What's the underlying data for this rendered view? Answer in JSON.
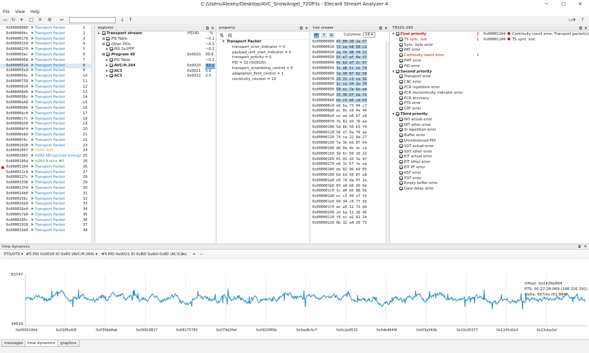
{
  "window": {
    "title": "C:/Users/Alexey/Desktop/AVC_SnowAngel_720P.ts - Elecard Stream Analyzer 4"
  },
  "menu": [
    "File",
    "View",
    "Help"
  ],
  "packets": [
    {
      "addr": "0x00000000",
      "label": "Transport Packet",
      "n": "1",
      "type": "pkt"
    },
    {
      "addr": "0x000000bc",
      "label": "Transport Packet",
      "n": "2",
      "type": "pkt"
    },
    {
      "addr": "0x00000178",
      "label": "Transport Packet",
      "n": "3",
      "type": "pkt"
    },
    {
      "addr": "0x00000234",
      "label": "Transport Packet",
      "n": "4",
      "type": "pkt"
    },
    {
      "addr": "0x000002f0",
      "label": "Transport Packet",
      "n": "5",
      "type": "pkt"
    },
    {
      "addr": "0x000003ac",
      "label": "Transport Packet",
      "n": "6",
      "type": "pkt"
    },
    {
      "addr": "0x00000468",
      "label": "Transport Packet",
      "n": "7",
      "type": "pkt"
    },
    {
      "addr": "0x00000524",
      "label": "Transport Packet",
      "n": "8",
      "type": "pkt",
      "selected": true
    },
    {
      "addr": "0x000005e0",
      "label": "Transport Packet",
      "n": "9",
      "type": "pkt"
    },
    {
      "addr": "0x0000069c",
      "label": "Transport Packet",
      "n": "10",
      "type": "pkt"
    },
    {
      "addr": "0x00000758",
      "label": "Transport Packet",
      "n": "11",
      "type": "pkt"
    },
    {
      "addr": "0x00000814",
      "label": "Transport Packet",
      "n": "12",
      "type": "pkt"
    },
    {
      "addr": "0x000008d0",
      "label": "Transport Packet",
      "n": "13",
      "type": "pkt"
    },
    {
      "addr": "0x0000098c",
      "label": "Transport Packet",
      "n": "14",
      "type": "pkt"
    },
    {
      "addr": "0x00000a48",
      "label": "Transport Packet",
      "n": "15",
      "type": "pkt"
    },
    {
      "addr": "0x00000b04",
      "label": "Transport Packet",
      "n": "16",
      "type": "pkt"
    },
    {
      "addr": "0x00000bc0",
      "label": "Transport Packet",
      "n": "17",
      "type": "pkt"
    },
    {
      "addr": "0x00000c7c",
      "label": "Transport Packet",
      "n": "18",
      "type": "pkt"
    },
    {
      "addr": "0x00000d38",
      "label": "Transport Packet",
      "n": "19",
      "type": "pkt"
    },
    {
      "addr": "0x00000df4",
      "label": "Transport Packet",
      "n": "20",
      "type": "pkt"
    },
    {
      "addr": "0x00000eb0",
      "label": "Transport Packet",
      "n": "21",
      "type": "pkt"
    },
    {
      "addr": "0x00000f6c",
      "label": "Transport Packet",
      "n": "22",
      "type": "pkt"
    },
    {
      "addr": "0x0000102B",
      "label": "Transport Packet",
      "n": "23",
      "type": "pkt"
    },
    {
      "addr": "0x0000105f",
      "label": "H264 AUD",
      "n": "24",
      "type": "aud"
    },
    {
      "addr": "0x00001065",
      "label": "H264 SEI (picture timing)",
      "n": "25",
      "type": "sei"
    },
    {
      "addr": "0x0000106d",
      "label": "H264 B slice #0",
      "n": "26",
      "type": "slice"
    },
    {
      "addr": "0x00001104",
      "label": "Transport Packet",
      "n": "26",
      "type": "pkt",
      "error": true
    },
    {
      "addr": "0x000011c0",
      "label": "Transport Packet",
      "n": "27",
      "type": "pkt"
    },
    {
      "addr": "0x0000127c",
      "label": "Transport Packet",
      "n": "28",
      "type": "pkt"
    },
    {
      "addr": "0x00001338",
      "label": "Transport Packet",
      "n": "29",
      "type": "pkt"
    },
    {
      "addr": "0x000013f4",
      "label": "Transport Packet",
      "n": "30",
      "type": "pkt"
    },
    {
      "addr": "0x000014b0",
      "label": "Transport Packet",
      "n": "31",
      "type": "pkt"
    },
    {
      "addr": "0x0000156c",
      "label": "Transport Packet",
      "n": "32",
      "type": "pkt"
    },
    {
      "addr": "0x00001628",
      "label": "Transport Packet",
      "n": "33",
      "type": "pkt"
    },
    {
      "addr": "0x000016e4",
      "label": "Transport Packet",
      "n": "34",
      "type": "pkt"
    },
    {
      "addr": "0x000017a0",
      "label": "Transport Packet",
      "n": "35",
      "type": "pkt"
    },
    {
      "addr": "0x0000185c",
      "label": "Transport Packet",
      "n": "36",
      "type": "pkt"
    },
    {
      "addr": "0x00001918",
      "label": "Transport Packet",
      "n": "37",
      "type": "pkt"
    },
    {
      "addr": "0x000019d4",
      "label": "Transport Packet",
      "n": "38",
      "type": "pkt"
    }
  ],
  "explorer": {
    "title": "explorer",
    "head": {
      "name": "Transport stream",
      "pid": "PID/ID",
      "pct": "%"
    },
    "rows": [
      {
        "name": "PSI Table",
        "pid": "",
        "pct": "~0.1",
        "indent": 1,
        "bold": false
      },
      {
        "name": "Other PIDs",
        "pid": "",
        "pct": "~0.1",
        "indent": 1,
        "bold": false
      },
      {
        "name": "PID 0x1FFF",
        "pid": "",
        "pct": "~0.1",
        "indent": 2,
        "bold": false
      },
      {
        "name": "Program #5",
        "pid": "0x0020",
        "pct": "99.8",
        "indent": 1,
        "bold": true,
        "italic": true
      },
      {
        "name": "PSI Table",
        "pid": "",
        "pct": "~0.1",
        "indent": 2,
        "bold": false
      },
      {
        "name": "AVC/H.264",
        "pid": "0x0020",
        "pct": "92.2",
        "indent": 2,
        "bold": true,
        "hl": true
      },
      {
        "name": "AC3",
        "pid": "0x0021",
        "pct": "5.0",
        "indent": 2,
        "bold": true
      },
      {
        "name": "AC3",
        "pid": "0x0022",
        "pct": "2.5",
        "indent": 2,
        "bold": true
      }
    ]
  },
  "property": {
    "title": "property",
    "header": "Transport Packet",
    "rows": [
      "transport_error_indicator  =  0",
      "payload_unit_start_indicator  =  0",
      "transport_priority  =  0",
      "PID  =  32 (0x0020)",
      "transport_scrambling_control  =  0",
      "adaptation_field_control  =  1",
      "continuity_counter  =  10"
    ]
  },
  "hexviewer": {
    "title": "hex viewer",
    "columns_label": "Columns:",
    "columns_value": "16",
    "rows": [
      {
        "a": "0x00000000",
        "b": "47 00 20 1a 57",
        "sel": true
      },
      {
        "a": "0x00000010",
        "b": "72 ea b8 68 c2",
        "sel": true
      },
      {
        "a": "0x00000020",
        "b": "2a fb 98 f4 21",
        "sel": true
      },
      {
        "a": "0x00000030",
        "b": "5f e7 af 4a f3",
        "sel": true
      },
      {
        "a": "0x00000040",
        "b": "4c b2 a7 2c bf",
        "sel": true
      },
      {
        "a": "0x00000050",
        "b": "fc a6 1c ce 79",
        "sel": true
      },
      {
        "a": "0x00000060",
        "b": "7a 30 87 82 50",
        "sel": true
      },
      {
        "a": "0x00000070",
        "b": "23 31 c3 ce 32",
        "sel": true
      },
      {
        "a": "0x00000080",
        "b": "1c ce 34 1e 70",
        "sel": true
      },
      {
        "a": "0x00000090",
        "b": "58 ec 7a 6e ed",
        "sel": true
      },
      {
        "a": "0x000000a0",
        "b": "15 3b 6f aa fd",
        "sel": true
      },
      {
        "a": "0x000000b0",
        "b": "b5 c5 b6 cd 69",
        "sel": true
      },
      {
        "a": "0x000000c0",
        "b": "e6 5a 73 04 c7",
        "sel": false
      },
      {
        "a": "0x000000d0",
        "b": "ac 8e e9 4a 44",
        "sel": false
      },
      {
        "a": "0x000000e0",
        "b": "ee ad b0 b7 e8",
        "sel": false
      },
      {
        "a": "0x000000f0",
        "b": "fb 81 d4 78 aa",
        "sel": false
      },
      {
        "a": "0x00000100",
        "b": "5d 6b 50 b3 f0",
        "sel": false
      },
      {
        "a": "0x00000110",
        "b": "58 e7 0a 74 aa",
        "sel": false
      },
      {
        "a": "0x00000120",
        "b": "74 ca 22 0a 27",
        "sel": false
      },
      {
        "a": "0x00000130",
        "b": "7a 3b bd 87 64",
        "sel": false
      },
      {
        "a": "0x00000140",
        "b": "d0 0a 4e dc ca",
        "sel": false
      },
      {
        "a": "0x00000150",
        "b": "39 6c 50 10 22",
        "sel": false
      },
      {
        "a": "0x00000160",
        "b": "01 01 d3 3a 9f",
        "sel": false
      },
      {
        "a": "0x00000170",
        "b": "e0 3c 57 fe ea",
        "sel": false
      },
      {
        "a": "0x00000180",
        "b": "de 82 96 b9 05",
        "sel": false
      },
      {
        "a": "0x00000190",
        "b": "6d b3 50 87 e8",
        "sel": false
      },
      {
        "a": "0x000001a0",
        "b": "e0 7d da 0f 2a",
        "sel": false
      },
      {
        "a": "0x000001b0",
        "b": "03 a9 b0 93 6d",
        "sel": false
      },
      {
        "a": "0x000001c0",
        "b": "1c d4 b6 88 5b",
        "sel": false
      },
      {
        "a": "0x000001d0",
        "b": "ec c3 44 e7 fb",
        "sel": false
      },
      {
        "a": "0x000001e0",
        "b": "94 34 c0 7f 5b",
        "sel": false
      },
      {
        "a": "0x000001f0",
        "b": "ae a5 12 f3 dd",
        "sel": false
      },
      {
        "a": "0x00000200",
        "b": "2d ba 13 38 46",
        "sel": false
      },
      {
        "a": "0x00000210",
        "b": "f9 ec a2 41 2d",
        "sel": false
      },
      {
        "a": "0x00000220",
        "b": "0b 12 a4 20 75",
        "sel": false
      }
    ]
  },
  "tr101": {
    "title": "TR101-290",
    "groups": [
      {
        "name": "First priority",
        "count": "2",
        "items": [
          {
            "n": "TS sync. lost",
            "c": "1",
            "red": true
          },
          {
            "n": "Sync. byte error",
            "c": "",
            "red": false
          },
          {
            "n": "PAT error",
            "c": "",
            "red": false
          },
          {
            "n": "Continuity count error",
            "c": "1",
            "red": true
          },
          {
            "n": "PMT error",
            "c": "",
            "red": false
          },
          {
            "n": "PID error",
            "c": "",
            "red": false
          }
        ]
      },
      {
        "name": "Second priority",
        "count": "",
        "items": [
          {
            "n": "Transport error",
            "c": "",
            "red": false
          },
          {
            "n": "CRC error",
            "c": "",
            "red": false
          },
          {
            "n": "PCR repetition error",
            "c": "",
            "red": false
          },
          {
            "n": "PCR discontinuity indicator error",
            "c": "",
            "red": false
          },
          {
            "n": "PCR accuracy",
            "c": "",
            "red": false
          },
          {
            "n": "PTS error",
            "c": "",
            "red": false
          },
          {
            "n": "CAT error",
            "c": "",
            "red": false
          }
        ]
      },
      {
        "name": "Third priority",
        "count": "",
        "items": [
          {
            "n": "NIT actual error",
            "c": "",
            "red": false
          },
          {
            "n": "NIT other error",
            "c": "",
            "red": false
          },
          {
            "n": "SI repetition error",
            "c": "",
            "red": false
          },
          {
            "n": "Buffer error",
            "c": "",
            "red": false
          },
          {
            "n": "Unreferenced PID",
            "c": "",
            "red": false
          },
          {
            "n": "SDT actual error",
            "c": "",
            "red": false
          },
          {
            "n": "SDT other error",
            "c": "",
            "red": false
          },
          {
            "n": "EIT actual error",
            "c": "",
            "red": false
          },
          {
            "n": "EIT other error",
            "c": "",
            "red": false
          },
          {
            "n": "EIT PF error",
            "c": "",
            "red": false
          },
          {
            "n": "RST error",
            "c": "",
            "red": false
          },
          {
            "n": "TDT error",
            "c": "",
            "red": false
          },
          {
            "n": "Empty buffer error",
            "c": "",
            "red": false
          },
          {
            "n": "Data delay error",
            "c": "",
            "red": false
          }
        ]
      }
    ],
    "messages": [
      {
        "addr": "0x00001104",
        "text": "Continuity count error. Transport packet(s)"
      },
      {
        "addr": "0x00001104",
        "text": "TS sync. lost."
      }
    ]
  },
  "time_dynamics": {
    "title": "time dynamics",
    "selector": "PTS/DTS",
    "stream1": "#5 PID 0x0020 ID 0xE0 (AVC/H.264)",
    "stream2": "#5 PID 0x0021 ID 0xBD SubId 0x80 (AC3)",
    "tools": [
      "|↔|",
      "+",
      "−"
    ],
    "ymax": "83747",
    "ymin": "34619",
    "xticks": [
      "0x000019d4",
      "0x0185e93f",
      "0x030bb8ab",
      "0x04918817",
      "0x06175783",
      "0x079d26ef",
      "0x0922f65b",
      "0x0aa8c5c7",
      "0x0c2e9533",
      "0x0db4649f",
      "0x0f3a340b",
      "0x10c00377",
      "0x1245d2e3",
      "0x13cba2af"
    ],
    "info": [
      "Offset: 0x1426b894",
      "PTS: 00:27:28:069 (148 326 291)",
      "Delta: 687ms (61 884)"
    ],
    "line_color": "#1c8dc4"
  },
  "tabs": [
    "messages",
    "time dynamics",
    "graphics"
  ]
}
